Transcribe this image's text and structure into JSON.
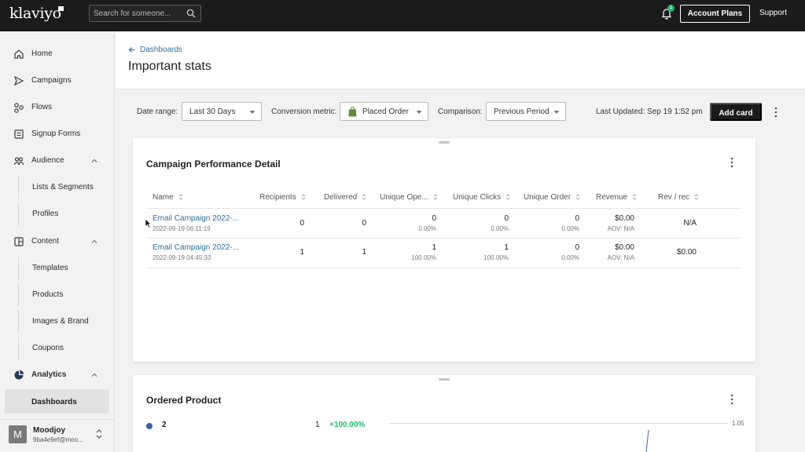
{
  "topbar": {
    "logo": "klaviyo",
    "search_placeholder": "Search for someone...",
    "notification_count": "1",
    "account_plans_label": "Account Plans",
    "support_label": "Support"
  },
  "sidebar": {
    "items": [
      {
        "label": "Home",
        "icon": "home-icon"
      },
      {
        "label": "Campaigns",
        "icon": "send-icon"
      },
      {
        "label": "Flows",
        "icon": "flows-icon"
      },
      {
        "label": "Signup Forms",
        "icon": "form-icon"
      },
      {
        "label": "Audience",
        "icon": "audience-icon"
      },
      {
        "label": "Content",
        "icon": "content-icon"
      },
      {
        "label": "Analytics",
        "icon": "analytics-icon"
      }
    ],
    "audience_sub": [
      "Lists & Segments",
      "Profiles"
    ],
    "content_sub": [
      "Templates",
      "Products",
      "Images & Brand",
      "Coupons"
    ],
    "analytics_sub": [
      "Dashboards"
    ],
    "user": {
      "initial": "M",
      "name": "Moodjoy",
      "id": "9ba4e9ef@moo..."
    }
  },
  "header": {
    "back_label": "Dashboards",
    "title": "Important stats"
  },
  "filters": {
    "date_range_label": "Date range:",
    "date_range_value": "Last 30 Days",
    "conversion_label": "Conversion metric:",
    "conversion_value": "Placed Order",
    "comparison_label": "Comparison:",
    "comparison_value": "Previous Period",
    "last_updated": "Last Updated: Sep 19 1:52 pm",
    "add_card_label": "Add card"
  },
  "campaign_card": {
    "title": "Campaign Performance Detail",
    "columns": [
      "Name",
      "Recipients",
      "Delivered",
      "Unique Ope...",
      "Unique Clicks",
      "Unique Order",
      "Revenue",
      "Rev / rec"
    ],
    "rows": [
      {
        "name": "Email Campaign 2022-...",
        "date": "2022-09-19 06:11:19",
        "recipients": "0",
        "delivered": "0",
        "opens": "0",
        "opens_pct": "0.00%",
        "clicks": "0",
        "clicks_pct": "0.00%",
        "orders": "0",
        "orders_pct": "0.00%",
        "revenue": "$0.00",
        "aov": "AOV: N/A",
        "rev_rec": "N/A"
      },
      {
        "name": "Email Campaign 2022-...",
        "date": "2022-09-19 04:45:33",
        "recipients": "1",
        "delivered": "1",
        "opens": "1",
        "opens_pct": "100.00%",
        "clicks": "1",
        "clicks_pct": "100.00%",
        "orders": "0",
        "orders_pct": "0.00%",
        "revenue": "$0.00",
        "aov": "AOV: N/A",
        "rev_rec": "$0.00"
      }
    ]
  },
  "ordered_card": {
    "title": "Ordered Product",
    "legend_label": "2",
    "legend_value": "1",
    "legend_change": "+100.00%",
    "axis_max": "1.05"
  },
  "colors": {
    "link": "#2f6e9f",
    "positive": "#2cb673",
    "series": "#3b5ea8",
    "topbar": "#1b1b1b"
  }
}
